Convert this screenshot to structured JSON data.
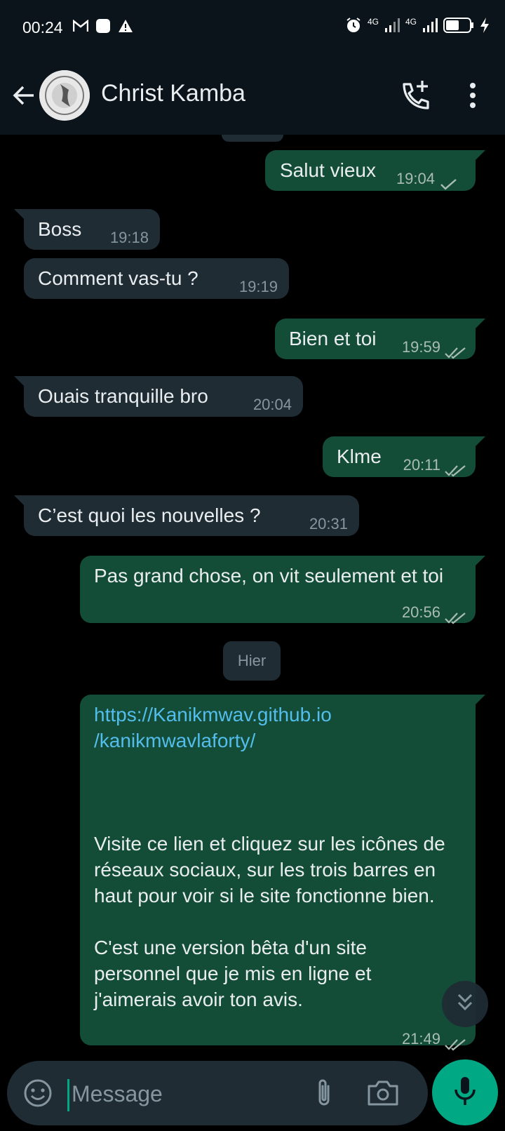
{
  "status_bar": {
    "time": "00:24",
    "left_icons": [
      "gmail-icon",
      "app-notification-icon",
      "warning-icon"
    ],
    "network_1": "4G",
    "network_2": "4G",
    "right_icons": [
      "alarm-icon",
      "signal-icon",
      "signal-icon",
      "battery-icon",
      "charging-icon"
    ]
  },
  "header": {
    "contact_name": "Christ Kamba",
    "icons": [
      "back-arrow-icon",
      "add-call-icon",
      "more-vert-icon"
    ]
  },
  "messages": [
    {
      "dir": "out",
      "text": "Salut vieux",
      "time": "19:04",
      "status": "sent"
    },
    {
      "dir": "in",
      "text": "Boss",
      "time": "19:18"
    },
    {
      "dir": "in",
      "text": "Comment vas-tu ?",
      "time": "19:19"
    },
    {
      "dir": "out",
      "text": "Bien et toi",
      "time": "19:59",
      "status": "delivered"
    },
    {
      "dir": "in",
      "text": "Ouais tranquille bro",
      "time": "20:04"
    },
    {
      "dir": "out",
      "text": "Klme",
      "time": "20:11",
      "status": "delivered"
    },
    {
      "dir": "in",
      "text": "C’est quoi les nouvelles ?",
      "time": "20:31"
    },
    {
      "dir": "out",
      "text": "Pas grand chose, on vit seulement et toi",
      "time": "20:56",
      "status": "delivered"
    }
  ],
  "day_separator": "Hier",
  "last_message": {
    "link_line1": "https://Kanikmwav.github.io",
    "link_line2": "/kanikmwavlaforty/",
    "body": "Visite ce lien et cliquez sur les icônes de réseaux sociaux, sur les trois barres en haut pour voir si le site fonctionne bien.\n\nC'est une version bêta d'un site personnel que je mis en ligne et j'aimerais avoir ton avis.",
    "time": "21:49",
    "status": "delivered"
  },
  "composer": {
    "placeholder": "Message",
    "icons": [
      "emoji-icon",
      "attach-icon",
      "camera-icon",
      "mic-icon"
    ]
  },
  "colors": {
    "background": "#000000",
    "header": "#0b141a",
    "outgoing_bubble": "#134d37",
    "incoming_bubble": "#1f2c34",
    "accent": "#00a884",
    "link": "#53bdeb"
  }
}
